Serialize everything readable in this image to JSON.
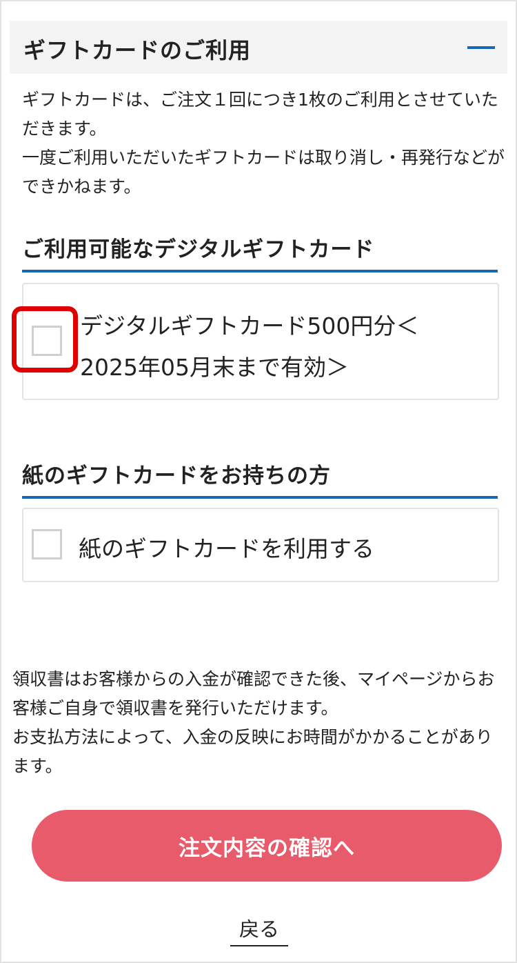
{
  "gift_section": {
    "title": "ギフトカードのご利用",
    "collapse_icon": "minus-icon",
    "intro_lines": [
      "ギフトカードは、ご注文１回につき1枚のご利用とさせていただきます。",
      "一度ご利用いただいたギフトカードは取り消し・再発行などができかねます。"
    ]
  },
  "digital_section": {
    "heading": "ご利用可能なデジタルギフトカード",
    "option_line1": "デジタルギフトカード500円分＜",
    "option_line2": "2025年05月末まで有効＞",
    "checked": false
  },
  "paper_section": {
    "heading": "紙のギフトカードをお持ちの方",
    "option_label": "紙のギフトカードを利用する",
    "checked": false
  },
  "receipt_note": {
    "lines": [
      "領収書はお客様からの入金が確認できた後、マイページからお客様ご自身で領収書を発行いただけます。",
      "お支払方法によって、入金の反映にお時間がかかることがあります。"
    ]
  },
  "actions": {
    "confirm_label": "注文内容の確認へ",
    "back_label": "戻る"
  },
  "colors": {
    "accent_blue": "#1766b8",
    "button_pink": "#e85b6b",
    "highlight_red": "#e00000"
  }
}
